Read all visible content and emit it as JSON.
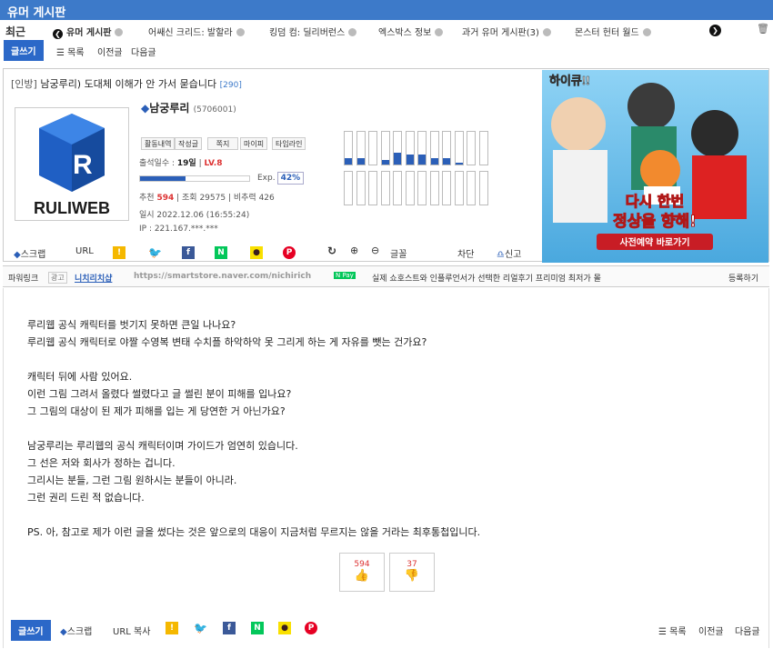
{
  "board": {
    "title": "유머 게시판"
  },
  "recent": {
    "label": "최근",
    "tabs": [
      "유머 게시판",
      "어쌔신 크리드: 발할라",
      "킹덤 컴: 딜리버런스",
      "엑스박스 정보",
      "과거 유머 게시판(3)",
      "몬스터 헌터 월드"
    ]
  },
  "toolbar": {
    "write": "글쓰기",
    "list": "목록",
    "prev": "이전글",
    "next": "다음글"
  },
  "post": {
    "category": "[인방]",
    "title": "남궁루리) 도대체 이해가 안 가서 묻습니다",
    "comment_count": "[290]"
  },
  "author": {
    "name": "남궁루리",
    "uid": "(5706001)",
    "profile_buttons": [
      "활동내역",
      "작성글",
      "쪽지",
      "마이피",
      "타임라인"
    ],
    "attendance_label": "출석일수 :",
    "attendance": "19일",
    "level": "LV.8",
    "exp_label": "Exp.",
    "exp_percent": "42%",
    "exp_value": 0.42,
    "recommend_label": "추천",
    "recommend": "594",
    "views_label": "조회",
    "views": "29575",
    "notrec_label": "비추력",
    "notrec": "426",
    "date": "일시 2022.12.06 (16:55:24)",
    "ip": "IP : 221.167.***.***",
    "logo_text": "RULIWEB"
  },
  "activity_graph": [
    0.2,
    0.2,
    0,
    0.15,
    0.35,
    0.3,
    0.3,
    0.2,
    0.2,
    0.05,
    0,
    0
  ],
  "share": {
    "scrap": "스크랩",
    "url": "URL",
    "font": "글꼴",
    "block": "차단",
    "report": "신고"
  },
  "powerlink": {
    "label": "파워링크",
    "ad_tag": "광고",
    "advertiser": "니치리치샵",
    "url": "https://smartstore.naver.com/nichirich",
    "npay": "N Pay",
    "desc": "실제 쇼호스트와 인플루언서가 선택한 리얼후기 프리미엄 최저가 몰",
    "register": "등록하기"
  },
  "ad_banner": {
    "game": "하이큐!!",
    "line1": "다시 한번",
    "line2": "정상을 향해!",
    "cta": "사전예약 바로가기",
    "bg": "#5bb8e8"
  },
  "body": [
    "루리웹 공식 캐릭터를 벗기지 못하면 큰일 나나요?",
    "루리웹 공식 캐릭터로 야짤 수영복 변태 수치플 하악하악 못 그리게 하는 게 자유를 뺏는 건가요?",
    "",
    "캐릭터 뒤에 사람 있어요.",
    "이런 그림 그려서 올렸다 썰렸다고 글 썰린 분이 피해를 입나요?",
    "그 그림의 대상이 된 제가 피해를 입는 게 당연한 거 아닌가요?",
    "",
    "남궁루리는 루리웹의 공식 캐릭터이며 가이드가 엄연히 있습니다.",
    "그 선은 저와 회사가 정하는 겁니다.",
    "그리시는 분들, 그런 그림 원하시는 분들이 아니라.",
    "그런 권리 드린 적 없습니다.",
    "",
    "PS. 아, 참고로 제가 이런 글을 썼다는 것은 앞으로의 대응이 지금처럼 무르지는 않을 거라는 최후통첩입니다."
  ],
  "votes": {
    "up": "594",
    "down": "37"
  },
  "bottom": {
    "write": "글쓰기",
    "scrap": "스크랩",
    "url_copy": "URL 복사",
    "list": "목록",
    "prev": "이전글",
    "next": "다음글"
  },
  "colors": {
    "accent": "#3d7ac9",
    "button": "#2b68c8",
    "twitter": "#1da1f2",
    "facebook": "#3b5998",
    "naver": "#03c75a",
    "kakao": "#f9e000",
    "pinterest": "#e60023"
  }
}
